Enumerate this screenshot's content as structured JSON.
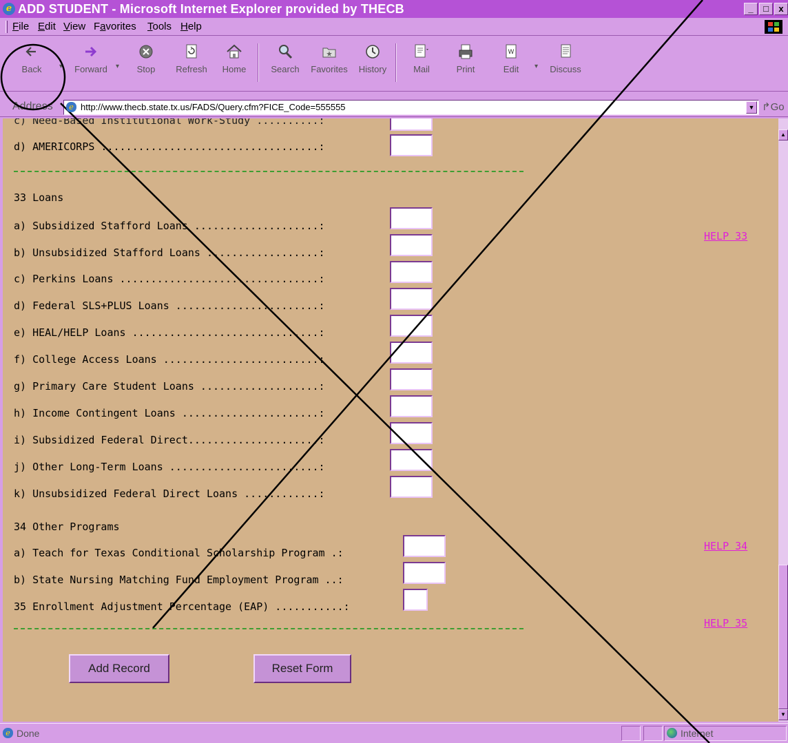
{
  "window": {
    "title": "ADD STUDENT - Microsoft Internet Explorer provided by THECB",
    "controls": {
      "minimize": "_",
      "maximize": "□",
      "close": "x"
    }
  },
  "menubar": {
    "items": [
      {
        "label": "File",
        "accel": "F",
        "rest": "ile"
      },
      {
        "label": "Edit",
        "accel": "E",
        "rest": "dit"
      },
      {
        "label": "View",
        "accel": "V",
        "rest": "iew"
      },
      {
        "label": "Favorites",
        "accel": "a",
        "pre": "F",
        "rest": "vorites"
      },
      {
        "label": "Tools",
        "accel": "T",
        "rest": "ools"
      },
      {
        "label": "Help",
        "accel": "H",
        "rest": "elp"
      }
    ]
  },
  "toolbar": {
    "back": "Back",
    "forward": "Forward",
    "stop": "Stop",
    "refresh": "Refresh",
    "home": "Home",
    "search": "Search",
    "favorites": "Favorites",
    "history": "History",
    "mail": "Mail",
    "print": "Print",
    "edit": "Edit",
    "discuss": "Discuss"
  },
  "address": {
    "label": "Address",
    "url": "http://www.thecb.state.tx.us/FADS/Query.cfm?FICE_Code=555555",
    "go": "Go"
  },
  "form": {
    "partial_line": "c) Need-Based Institutional Work-Study ..........:",
    "americorps": "d) AMERICORPS ...................................:",
    "section33": "33 Loans",
    "loans": [
      "a) Subsidized Stafford Loans ....................:",
      "b) Unsubsidized Stafford Loans ..................:",
      "c) Perkins Loans ................................:",
      "d) Federal SLS+PLUS Loans .......................:",
      "e) HEAL/HELP Loans ..............................:",
      "f) College Access Loans .........................:",
      "g) Primary Care Student Loans ...................:",
      "h) Income Contingent Loans ......................:",
      "i) Subsidized Federal Direct.....................:",
      "j) Other Long-Term Loans ........................:",
      "k) Unsubsidized Federal Direct Loans ............:"
    ],
    "section34": "34 Other Programs",
    "other_programs": [
      "a) Teach for Texas Conditional Scholarship Program .:",
      "b) State Nursing Matching Fund Employment Program ..:"
    ],
    "section35": "35 Enrollment Adjustment Percentage (EAP) ...........:",
    "help33": "HELP 33",
    "help34": "HELP 34",
    "help35": "HELP 35",
    "add_record": "Add Record",
    "reset_form": "Reset Form"
  },
  "status": {
    "text": "Done",
    "zone": "Internet"
  },
  "colors": {
    "chrome": "#d69ee6",
    "titlebar": "#b552d6",
    "page_bg": "#d3b28a",
    "help_link": "#e020d8",
    "divider": "#3f9d32"
  }
}
